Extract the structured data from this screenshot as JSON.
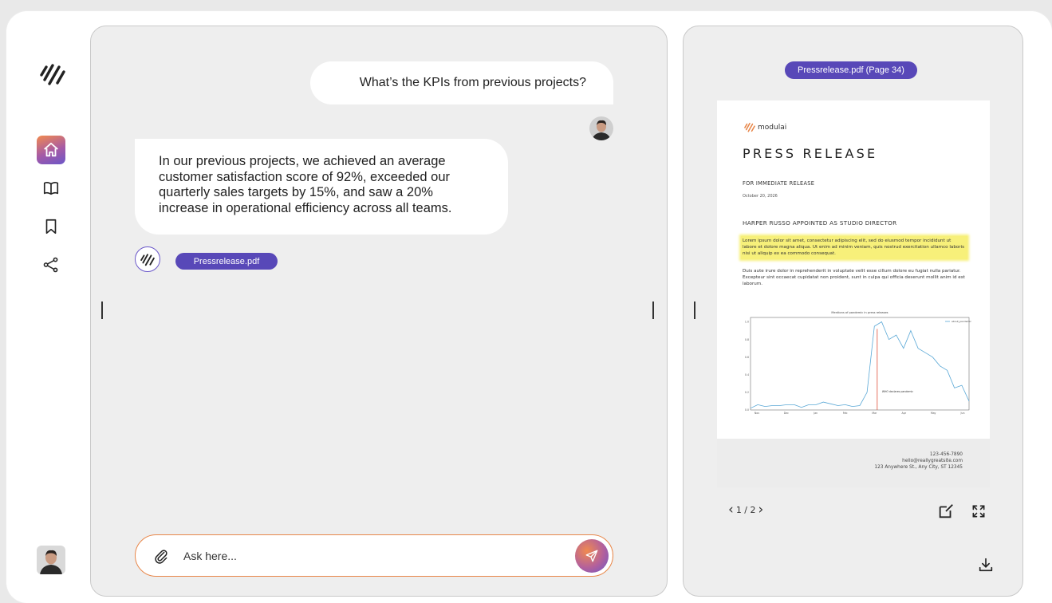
{
  "app": {
    "name": "modulai"
  },
  "sidebar": {
    "items": [
      {
        "label": "home",
        "icon": "home-icon",
        "active": true
      },
      {
        "label": "library",
        "icon": "book-icon",
        "active": false
      },
      {
        "label": "saved",
        "icon": "bookmark-icon",
        "active": false
      },
      {
        "label": "share",
        "icon": "share-icon",
        "active": false
      }
    ]
  },
  "chat": {
    "question": "What’s the KPIs from previous projects?",
    "answer": "In our previous projects, we achieved an average customer satisfaction score of 92%, exceeded our quarterly sales targets by 15%, and saw a 20% increase in operational efficiency across all teams.",
    "source": "Pressrelease.pdf",
    "input_placeholder": "Ask here..."
  },
  "preview": {
    "page_label": "Pressrelease.pdf (Page 34)",
    "pager": "1 / 2",
    "doc": {
      "brand": "modulai",
      "title": "PRESS RELEASE",
      "subtitle": "FOR IMMEDIATE RELEASE",
      "date": "October 20, 2026",
      "headline": "HARPER RUSSO APPOINTED AS STUDIO DIRECTOR",
      "highlight": "Lorem ipsum dolor sit amet, consectetur adipiscing elit, sed do eiusmod tempor incididunt ut labore et dolore magna aliqua. Ut enim ad minim veniam, quis nostrud exercitation ullamco laboris nisi ut aliquip ex ea commodo consequat.",
      "paragraph": "Duis aute irure dolor in reprehenderit in voluptate velit esse cillum dolore eu fugiat nulla pariatur. Excepteur sint occaecat cupidatat non proident, sunt in culpa qui officia deserunt mollit anim id est laborum.",
      "phone": "123-456-7890",
      "email": "hello@reallygreatsite.com",
      "address": "123 Anywhere St., Any City, ST 12345"
    }
  },
  "chart_data": {
    "type": "line",
    "title": "Mentions of pandemic in press releases",
    "legend": "about_pandemic",
    "annotation": "WHO declares pandemic",
    "x_ticks": [
      "Nov",
      "Dec",
      "Jan\n2020",
      "Feb",
      "Mar",
      "Apr",
      "May",
      "Jun"
    ],
    "y_ticks": [
      "0.0",
      "0.2",
      "0.4",
      "0.6",
      "0.8",
      "1.0"
    ],
    "ylim": [
      0,
      1.05
    ],
    "marker_x": 17.5,
    "values": [
      0.02,
      0.06,
      0.04,
      0.05,
      0.05,
      0.06,
      0.06,
      0.03,
      0.06,
      0.06,
      0.09,
      0.07,
      0.05,
      0.06,
      0.04,
      0.05,
      0.2,
      0.95,
      1.0,
      0.8,
      0.85,
      0.7,
      0.9,
      0.7,
      0.65,
      0.6,
      0.5,
      0.45,
      0.25,
      0.28,
      0.1
    ],
    "colors": {
      "line": "#5aa8d6",
      "marker": "#e0503a"
    }
  },
  "colors": {
    "accent": "#5848b8",
    "orange": "#e8874a",
    "highlight": "#f7f07a"
  }
}
